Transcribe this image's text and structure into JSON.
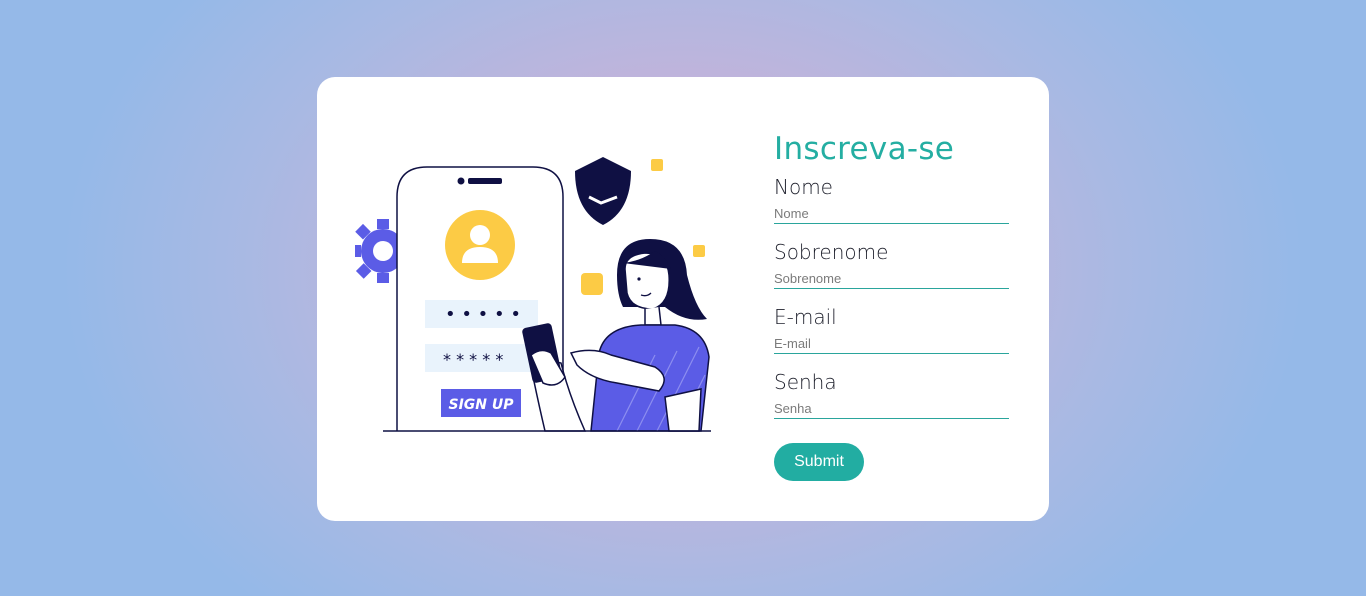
{
  "illustration": {
    "signup_label": "SIGN UP",
    "password_mask_1": "• • • • •",
    "password_mask_2": "* * * * *"
  },
  "form": {
    "title": "Inscreva-se",
    "fields": [
      {
        "label": "Nome",
        "placeholder": "Nome"
      },
      {
        "label": "Sobrenome",
        "placeholder": "Sobrenome"
      },
      {
        "label": "E-mail",
        "placeholder": "E-mail"
      },
      {
        "label": "Senha",
        "placeholder": "Senha"
      }
    ],
    "submit_label": "Submit"
  },
  "colors": {
    "accent": "#22ada2",
    "card": "#ffffff",
    "illustration_blue": "#5b5ce6",
    "illustration_yellow": "#fccb45",
    "illustration_dark": "#0f1043"
  }
}
